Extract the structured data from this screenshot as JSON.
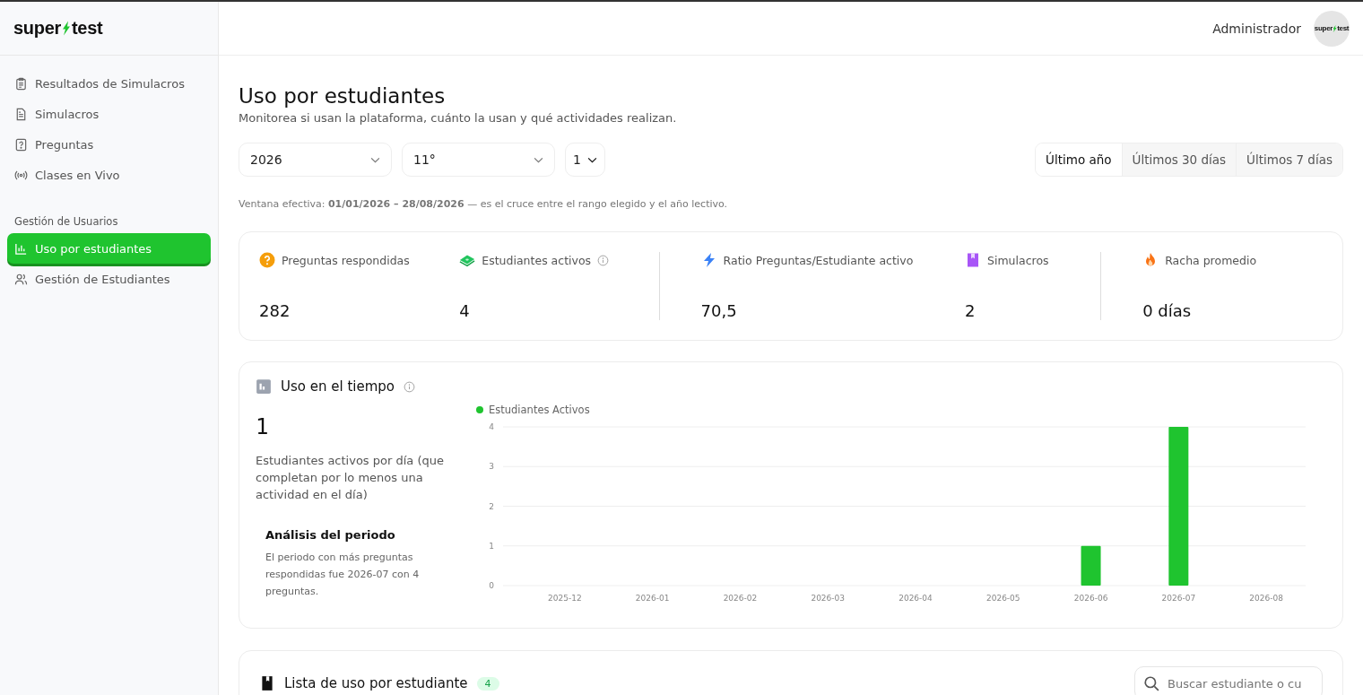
{
  "logo": {
    "left": "super",
    "right": "test"
  },
  "sidebar": {
    "items": [
      {
        "label": "Resultados de Simulacros",
        "kind": "clipboard",
        "selected": false
      },
      {
        "label": "Simulacros",
        "kind": "document",
        "selected": false
      },
      {
        "label": "Preguntas",
        "kind": "question",
        "selected": false
      },
      {
        "label": "Clases en Vivo",
        "kind": "broadcast",
        "selected": false
      }
    ],
    "sections": [
      {
        "title": "Gestión de Usuarios",
        "items": [
          {
            "label": "Uso por estudiantes",
            "kind": "chart",
            "selected": true
          },
          {
            "label": "Gestión de Estudiantes",
            "kind": "users",
            "selected": false
          }
        ]
      }
    ]
  },
  "header": {
    "user": "Administrador",
    "avatar_logo": {
      "left": "super",
      "right": "test"
    }
  },
  "page": {
    "title": "Uso por estudiantes",
    "subtitle": "Monitorea si usan la plataforma, cuánto la usan y qué actividades realizan."
  },
  "filters": [
    {
      "value": "2026"
    },
    {
      "value": "11°"
    },
    {
      "value": "1"
    }
  ],
  "ranges": [
    {
      "label": "Último año",
      "selected": true
    },
    {
      "label": "Últimos 30 días",
      "selected": false
    },
    {
      "label": "Últimos 7 días",
      "selected": false
    }
  ],
  "window_note": "Ventana efectiva: **01/01/2026 – 28/08/2026** — es el cruce entre el rango elegido y el año lectivo.",
  "stat_groups": [
    [
      {
        "label": "Preguntas respondidas",
        "value": "282",
        "kind": "question",
        "info": false
      },
      {
        "label": "Estudiantes activos",
        "value": "4",
        "kind": "money",
        "info": true
      }
    ],
    [
      {
        "label": "Ratio Preguntas/Estudiante activo",
        "value": "70,5",
        "kind": "bolt",
        "info": false
      },
      {
        "label": "Simulacros",
        "value": "2",
        "kind": "book",
        "info": false
      }
    ],
    [
      {
        "label": "Racha promedio",
        "value": "0 días",
        "kind": "fire",
        "info": false
      }
    ]
  ],
  "usage": {
    "title": "Uso en el tiempo",
    "big_value": "1",
    "description": "Estudiantes activos por día (que completan por lo menos una actividad en el día)",
    "analysis_title": "Análisis del periodo",
    "analysis_text": "El periodo con más preguntas respondidas fue 2026-07 con 4 preguntas.",
    "chart_data": {
      "type": "bar",
      "categories": [
        "2025-12",
        "2026-01",
        "2026-02",
        "2026-03",
        "2026-04",
        "2026-05",
        "2026-06",
        "2026-07",
        "2026-08"
      ],
      "series": [
        {
          "name": "Estudiantes Activos",
          "color": "#1fc42f",
          "values": [
            0,
            0,
            0,
            0,
            0,
            0,
            1,
            4,
            0
          ]
        }
      ],
      "ylim": [
        0,
        4
      ],
      "yticks": [
        0,
        1,
        2,
        3,
        4
      ],
      "grid": true
    }
  },
  "student_list": {
    "title": "Lista de uso por estudiante",
    "count": "4",
    "search": {
      "placeholder": "Buscar estudiante o cu"
    }
  }
}
